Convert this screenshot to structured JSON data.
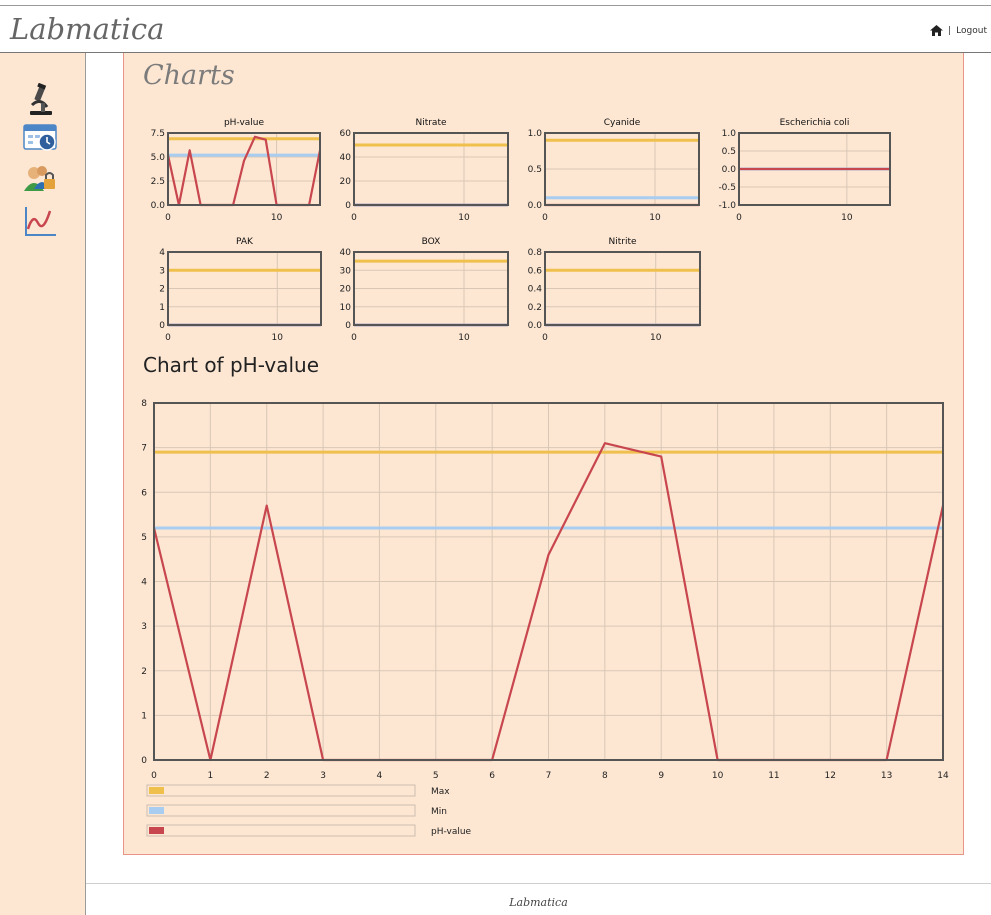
{
  "app": {
    "title": "Labmatica",
    "footer": "Labmatica"
  },
  "header": {
    "separator": "|",
    "logout_label": "Logout",
    "home_icon": "home-icon"
  },
  "sidebar": {
    "items": [
      {
        "name": "microscope-icon",
        "label": ""
      },
      {
        "name": "calendar-clock-icon",
        "label": ""
      },
      {
        "name": "users-lock-icon",
        "label": ""
      },
      {
        "name": "line-chart-icon",
        "label": ""
      }
    ]
  },
  "page": {
    "title": "Charts",
    "main_chart_title": "Chart of pH-value"
  },
  "colors": {
    "max": "#f0c04c",
    "min": "#a8cdf0",
    "value": "#c8464e",
    "background": "#fde7d3"
  },
  "chart_data": [
    {
      "type": "line",
      "title": "pH-value",
      "x": [
        0,
        1,
        2,
        3,
        4,
        5,
        6,
        7,
        8,
        9,
        10,
        11,
        12,
        13,
        14
      ],
      "xlim": [
        0,
        14
      ],
      "xticks": [
        "0",
        "10"
      ],
      "ylim": [
        0,
        7.5
      ],
      "yticks": [
        "0.0",
        "2.5",
        "5.0",
        "7.5"
      ],
      "series": [
        {
          "name": "Max",
          "values": [
            6.9,
            6.9,
            6.9,
            6.9,
            6.9,
            6.9,
            6.9,
            6.9,
            6.9,
            6.9,
            6.9,
            6.9,
            6.9,
            6.9,
            6.9
          ]
        },
        {
          "name": "Min",
          "values": [
            5.2,
            5.2,
            5.2,
            5.2,
            5.2,
            5.2,
            5.2,
            5.2,
            5.2,
            5.2,
            5.2,
            5.2,
            5.2,
            5.2,
            5.2
          ]
        },
        {
          "name": "pH-value",
          "values": [
            5.2,
            0,
            5.7,
            0,
            0,
            0,
            0,
            4.6,
            7.1,
            6.8,
            0,
            0,
            0,
            0,
            5.7
          ]
        }
      ]
    },
    {
      "type": "line",
      "title": "Nitrate",
      "x": [
        0,
        14
      ],
      "xlim": [
        0,
        14
      ],
      "xticks": [
        "0",
        "10"
      ],
      "ylim": [
        0,
        60
      ],
      "yticks": [
        "0",
        "20",
        "40",
        "60"
      ],
      "series": [
        {
          "name": "Max",
          "values": [
            50,
            50
          ]
        },
        {
          "name": "Min",
          "values": [
            0,
            0
          ]
        },
        {
          "name": "Nitrate",
          "values": [
            0,
            0
          ]
        }
      ]
    },
    {
      "type": "line",
      "title": "Cyanide",
      "x": [
        0,
        14
      ],
      "xlim": [
        0,
        14
      ],
      "xticks": [
        "0",
        "10"
      ],
      "ylim": [
        0,
        1
      ],
      "yticks": [
        "0.0",
        "0.5",
        "1.0"
      ],
      "series": [
        {
          "name": "Max",
          "values": [
            0.9,
            0.9
          ]
        },
        {
          "name": "Min",
          "values": [
            0.1,
            0.1
          ]
        },
        {
          "name": "Cyanide",
          "values": [
            0,
            0
          ]
        }
      ]
    },
    {
      "type": "line",
      "title": "Escherichia coli",
      "x": [
        0,
        14
      ],
      "xlim": [
        0,
        14
      ],
      "xticks": [
        "0",
        "10"
      ],
      "ylim": [
        -1,
        1
      ],
      "yticks": [
        "-1.0",
        "-0.5",
        "0.0",
        "0.5",
        "1.0"
      ],
      "series": [
        {
          "name": "Max",
          "values": [
            0,
            0
          ]
        },
        {
          "name": "Min",
          "values": [
            0,
            0
          ]
        },
        {
          "name": "Escherichia coli",
          "values": [
            0,
            0
          ]
        }
      ]
    },
    {
      "type": "line",
      "title": "PAK",
      "x": [
        0,
        14
      ],
      "xlim": [
        0,
        14
      ],
      "xticks": [
        "0",
        "10"
      ],
      "ylim": [
        0,
        4
      ],
      "yticks": [
        "0",
        "1",
        "2",
        "3",
        "4"
      ],
      "series": [
        {
          "name": "Max",
          "values": [
            3,
            3
          ]
        },
        {
          "name": "Min",
          "values": [
            0,
            0
          ]
        },
        {
          "name": "PAK",
          "values": [
            0,
            0
          ]
        }
      ]
    },
    {
      "type": "line",
      "title": "BOX",
      "x": [
        0,
        14
      ],
      "xlim": [
        0,
        14
      ],
      "xticks": [
        "0",
        "10"
      ],
      "ylim": [
        0,
        40
      ],
      "yticks": [
        "0",
        "10",
        "20",
        "30",
        "40"
      ],
      "series": [
        {
          "name": "Max",
          "values": [
            35,
            35
          ]
        },
        {
          "name": "Min",
          "values": [
            0,
            0
          ]
        },
        {
          "name": "BOX",
          "values": [
            0,
            0
          ]
        }
      ]
    },
    {
      "type": "line",
      "title": "Nitrite",
      "x": [
        0,
        14
      ],
      "xlim": [
        0,
        14
      ],
      "xticks": [
        "0",
        "10"
      ],
      "ylim": [
        0,
        0.8
      ],
      "yticks": [
        "0.0",
        "0.2",
        "0.4",
        "0.6",
        "0.8"
      ],
      "series": [
        {
          "name": "Max",
          "values": [
            0.6,
            0.6
          ]
        },
        {
          "name": "Min",
          "values": [
            0,
            0
          ]
        },
        {
          "name": "Nitrite",
          "values": [
            0,
            0
          ]
        }
      ]
    },
    {
      "type": "line",
      "title": "",
      "x": [
        0,
        1,
        2,
        3,
        4,
        5,
        6,
        7,
        8,
        9,
        10,
        11,
        12,
        13,
        14
      ],
      "xlim": [
        0,
        14
      ],
      "xticks": [
        "0",
        "1",
        "2",
        "3",
        "4",
        "5",
        "6",
        "7",
        "8",
        "9",
        "10",
        "11",
        "12",
        "13",
        "14"
      ],
      "ylim": [
        0,
        8
      ],
      "yticks": [
        "0",
        "1",
        "2",
        "3",
        "4",
        "5",
        "6",
        "7",
        "8"
      ],
      "series": [
        {
          "name": "Max",
          "values": [
            6.9,
            6.9,
            6.9,
            6.9,
            6.9,
            6.9,
            6.9,
            6.9,
            6.9,
            6.9,
            6.9,
            6.9,
            6.9,
            6.9,
            6.9
          ]
        },
        {
          "name": "Min",
          "values": [
            5.2,
            5.2,
            5.2,
            5.2,
            5.2,
            5.2,
            5.2,
            5.2,
            5.2,
            5.2,
            5.2,
            5.2,
            5.2,
            5.2,
            5.2
          ]
        },
        {
          "name": "pH-value",
          "values": [
            5.2,
            0,
            5.7,
            0,
            0,
            0,
            0,
            4.6,
            7.1,
            6.8,
            0,
            0,
            0,
            0,
            5.7
          ]
        }
      ],
      "legend": [
        "Max",
        "Min",
        "pH-value"
      ]
    }
  ]
}
